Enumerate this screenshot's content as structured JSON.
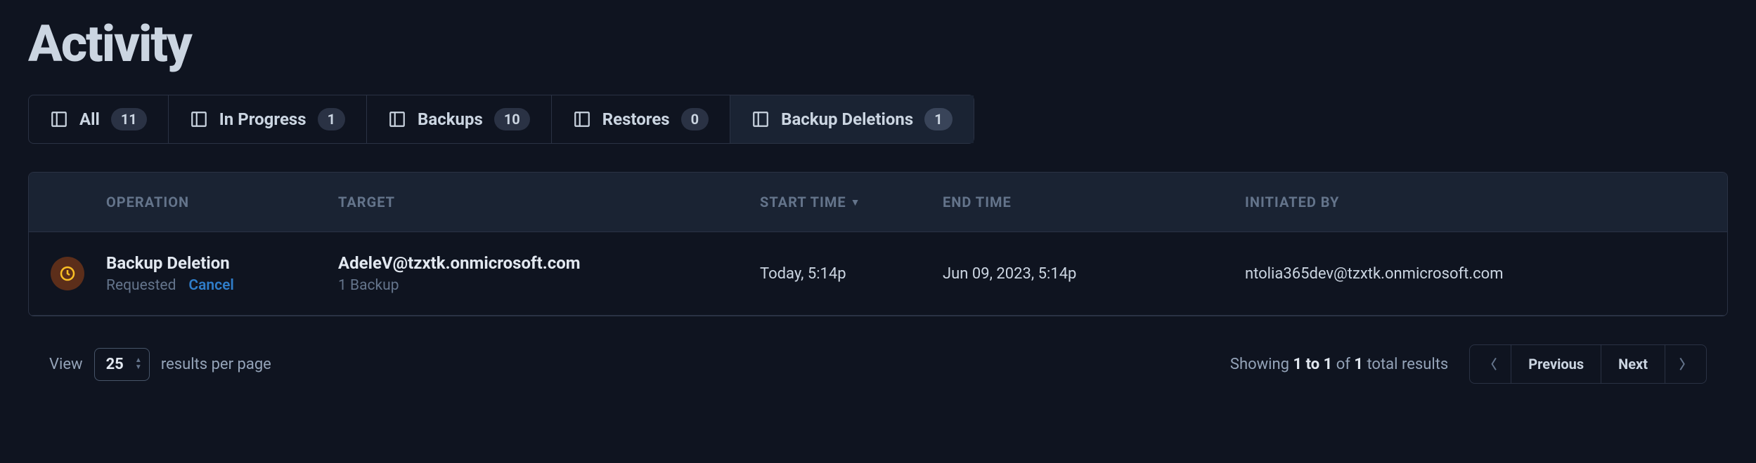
{
  "title": "Activity",
  "tabs": [
    {
      "label": "All",
      "count": "11"
    },
    {
      "label": "In Progress",
      "count": "1"
    },
    {
      "label": "Backups",
      "count": "10"
    },
    {
      "label": "Restores",
      "count": "0"
    },
    {
      "label": "Backup Deletions",
      "count": "1"
    }
  ],
  "headers": {
    "operation": "OPERATION",
    "target": "TARGET",
    "start_time": "START TIME",
    "end_time": "END TIME",
    "initiated_by": "INITIATED BY"
  },
  "row": {
    "operation_name": "Backup Deletion",
    "operation_status": "Requested",
    "cancel_label": "Cancel",
    "target_email": "AdeleV@tzxtk.onmicrosoft.com",
    "target_sub": "1 Backup",
    "start_time": "Today, 5:14p",
    "end_time": "Jun 09, 2023, 5:14p",
    "initiated_by": "ntolia365dev@tzxtk.onmicrosoft.com"
  },
  "footer": {
    "view_label": "View",
    "page_size": "25",
    "results_label": "results per page",
    "showing_prefix": "Showing ",
    "showing_range": "1 to 1",
    "showing_mid": " of ",
    "showing_total": "1",
    "showing_suffix": " total results",
    "prev_label": "Previous",
    "next_label": "Next"
  }
}
